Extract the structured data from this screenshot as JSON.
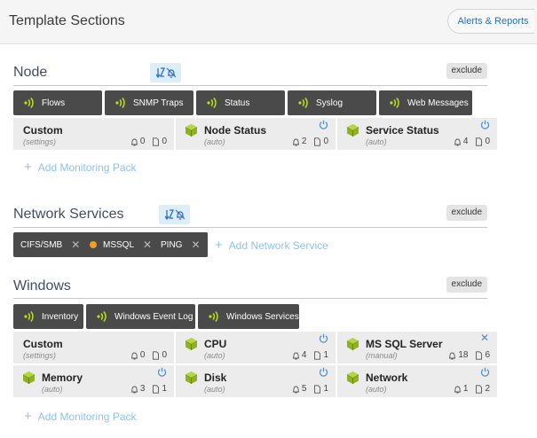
{
  "header": {
    "title": "Template Sections",
    "alerts_button": "Alerts & Reports"
  },
  "common": {
    "exclude_label": "exclude"
  },
  "node": {
    "title": "Node",
    "chips": [
      "Flows",
      "SNMP Traps",
      "Status",
      "Syslog",
      "Web Messages"
    ],
    "cards": [
      {
        "title": "Custom",
        "subtitle": "(settings)",
        "alerts": "0",
        "docs": "0"
      },
      {
        "title": "Node Status",
        "subtitle": "(auto)",
        "alerts": "2",
        "docs": "0"
      },
      {
        "title": "Service Status",
        "subtitle": "(auto)",
        "alerts": "4",
        "docs": "0"
      }
    ],
    "add_label": "Add Monitoring Pack"
  },
  "network": {
    "title": "Network Services",
    "services": [
      {
        "label": "CIFS/SMB"
      },
      {
        "label": "MSSQL",
        "status_color": "#f0a020"
      },
      {
        "label": "PING"
      }
    ],
    "add_label": "Add Network Service"
  },
  "windows": {
    "title": "Windows",
    "chips": [
      "Inventory",
      "Windows Event Log",
      "Windows Services"
    ],
    "cards": [
      {
        "title": "Custom",
        "subtitle": "(settings)",
        "alerts": "0",
        "docs": "0"
      },
      {
        "title": "CPU",
        "subtitle": "(auto)",
        "alerts": "4",
        "docs": "1"
      },
      {
        "title": "MS SQL Server",
        "subtitle": "(manual)",
        "alerts": "18",
        "docs": "6"
      },
      {
        "title": "Memory",
        "subtitle": "(auto)",
        "alerts": "3",
        "docs": "1"
      },
      {
        "title": "Disk",
        "subtitle": "(auto)",
        "alerts": "5",
        "docs": "1"
      },
      {
        "title": "Network",
        "subtitle": "(auto)",
        "alerts": "1",
        "docs": "2"
      }
    ],
    "add_label": "Add Monitoring Pack"
  },
  "colors": {
    "chip_bg": "#4a4a4a",
    "signal": "#b5e61d",
    "cube": "#8db31e",
    "link": "#8ec3ea",
    "accent": "#2c6fbf"
  }
}
